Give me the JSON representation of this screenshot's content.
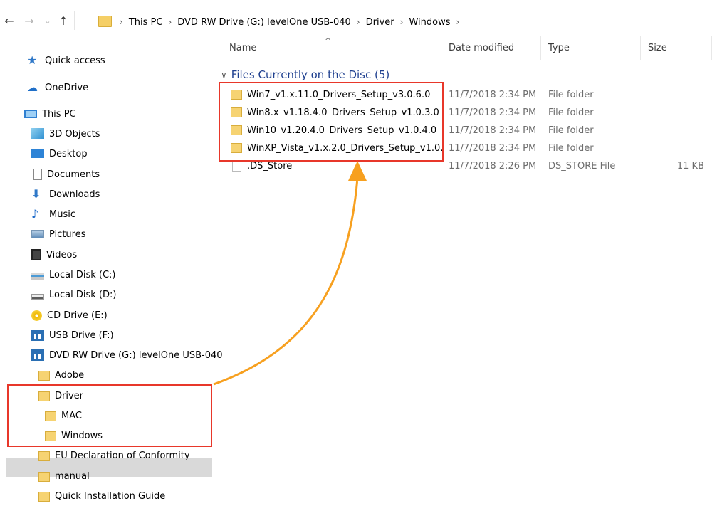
{
  "nav": {
    "back_icon": "arrow-left-icon",
    "forward_icon": "arrow-right-icon",
    "recent_icon": "chevron-down-icon",
    "up_icon": "arrow-up-icon",
    "breadcrumbs": [
      "This PC",
      "DVD RW Drive (G:) levelOne USB-040",
      "Driver",
      "Windows"
    ],
    "separator": "›"
  },
  "columns": {
    "name": "Name",
    "date": "Date modified",
    "type": "Type",
    "size": "Size"
  },
  "group": {
    "label": "Files Currently on the Disc (5)"
  },
  "files": [
    {
      "name": "Win7_v1.x.11.0_Drivers_Setup_v3.0.6.0",
      "date": "11/7/2018 2:34 PM",
      "type": "File folder",
      "size": "",
      "icon": "folder-icon"
    },
    {
      "name": "Win8.x_v1.18.4.0_Drivers_Setup_v1.0.3.0",
      "date": "11/7/2018 2:34 PM",
      "type": "File folder",
      "size": "",
      "icon": "folder-icon"
    },
    {
      "name": "Win10_v1.20.4.0_Drivers_Setup_v1.0.4.0",
      "date": "11/7/2018 2:34 PM",
      "type": "File folder",
      "size": "",
      "icon": "folder-icon"
    },
    {
      "name": "WinXP_Vista_v1.x.2.0_Drivers_Setup_v1.0.",
      "date": "11/7/2018 2:34 PM",
      "type": "File folder",
      "size": "",
      "icon": "folder-icon"
    },
    {
      "name": ".DS_Store",
      "date": "11/7/2018 2:26 PM",
      "type": "DS_STORE File",
      "size": "11 KB",
      "icon": "file-icon"
    }
  ],
  "sidebar": {
    "items": [
      {
        "label": "Quick access",
        "icon": "star-icon"
      },
      {
        "label": "OneDrive",
        "icon": "cloud-icon"
      },
      {
        "label": "This PC",
        "icon": "computer-icon"
      },
      {
        "label": "3D Objects",
        "icon": "cube-icon"
      },
      {
        "label": "Desktop",
        "icon": "desktop-icon"
      },
      {
        "label": "Documents",
        "icon": "document-icon"
      },
      {
        "label": "Downloads",
        "icon": "download-icon"
      },
      {
        "label": "Music",
        "icon": "music-note-icon"
      },
      {
        "label": "Pictures",
        "icon": "picture-icon"
      },
      {
        "label": "Videos",
        "icon": "film-icon"
      },
      {
        "label": "Local Disk (C:)",
        "icon": "system-drive-icon"
      },
      {
        "label": "Local Disk (D:)",
        "icon": "drive-icon"
      },
      {
        "label": "CD Drive (E:)",
        "icon": "cd-drive-icon"
      },
      {
        "label": "USB Drive (F:)",
        "icon": "usb-drive-icon"
      },
      {
        "label": "DVD RW Drive (G:) levelOne USB-040",
        "icon": "usb-drive-icon"
      },
      {
        "label": "Adobe",
        "icon": "folder-icon"
      },
      {
        "label": "Driver",
        "icon": "folder-icon"
      },
      {
        "label": "MAC",
        "icon": "folder-icon"
      },
      {
        "label": "Windows",
        "icon": "folder-icon",
        "selected": true
      },
      {
        "label": "EU Declaration of Conformity",
        "icon": "folder-icon"
      },
      {
        "label": "manual",
        "icon": "folder-icon"
      },
      {
        "label": "Quick Installation Guide",
        "icon": "folder-icon"
      }
    ]
  },
  "colors": {
    "highlight_box": "#e8372a",
    "arrow": "#f7a01f",
    "group_header": "#1e3f8f",
    "selection": "#d9d9d9"
  }
}
